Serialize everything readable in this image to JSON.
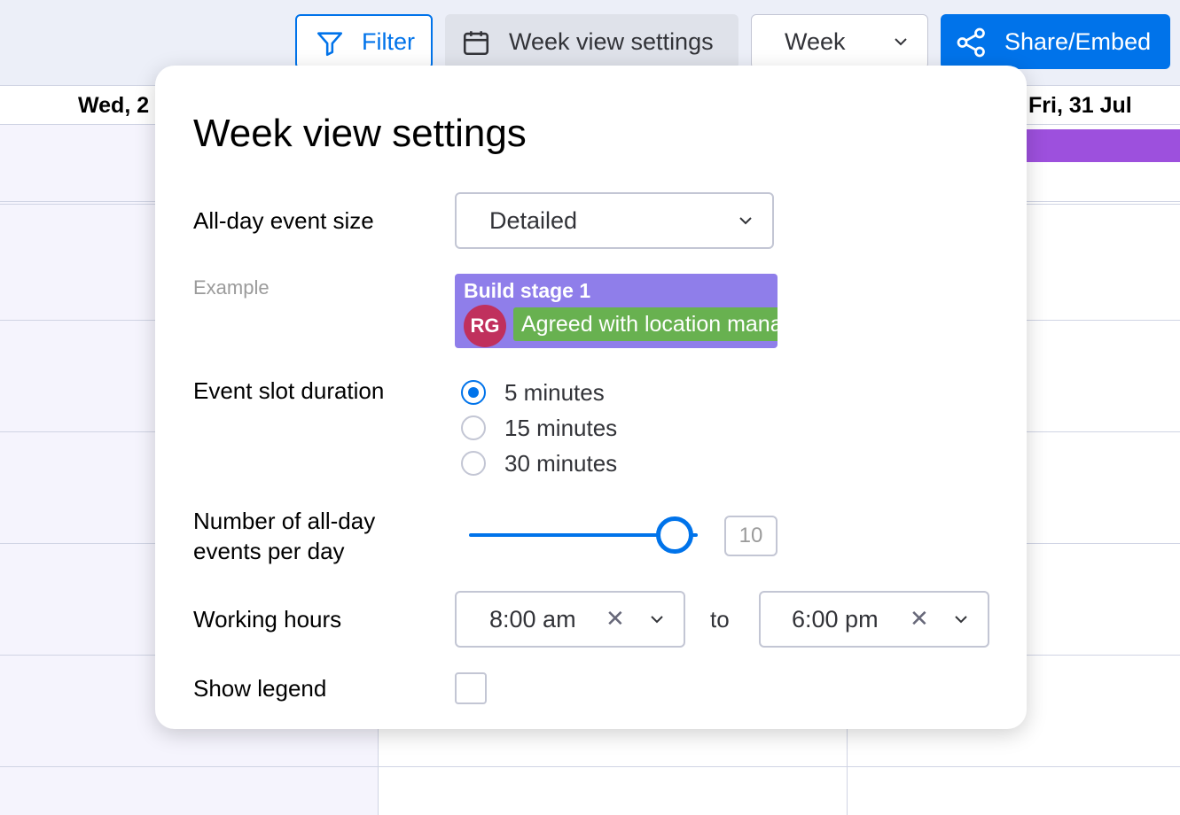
{
  "toolbar": {
    "filter_label": "Filter",
    "week_view_settings_label": "Week view settings",
    "view_select_value": "Week",
    "share_label": "Share/Embed"
  },
  "calendar": {
    "day_headers": [
      "Wed, 2",
      "Fri, 31 Jul"
    ]
  },
  "popover": {
    "title": "Week view settings",
    "all_day_event_size": {
      "label": "All-day event size",
      "value": "Detailed"
    },
    "example": {
      "label": "Example",
      "event_title": "Build stage 1",
      "avatar_initials": "RG",
      "status_tag": "Agreed with location manager"
    },
    "event_slot_duration": {
      "label": "Event slot duration",
      "options": [
        "5 minutes",
        "15 minutes",
        "30 minutes"
      ],
      "selected": "5 minutes"
    },
    "all_day_events_per_day": {
      "label_line1": "Number of all-day",
      "label_line2": "events per day",
      "value": "10"
    },
    "working_hours": {
      "label": "Working hours",
      "from": "8:00 am",
      "to_label": "to",
      "to": "6:00 pm"
    },
    "show_legend": {
      "label": "Show legend",
      "checked": false
    }
  },
  "colors": {
    "primary": "#0073ea",
    "example_event": "#8f7eea",
    "status_green": "#68b150",
    "avatar": "#c0305d",
    "friday_event": "#9d50dd"
  }
}
